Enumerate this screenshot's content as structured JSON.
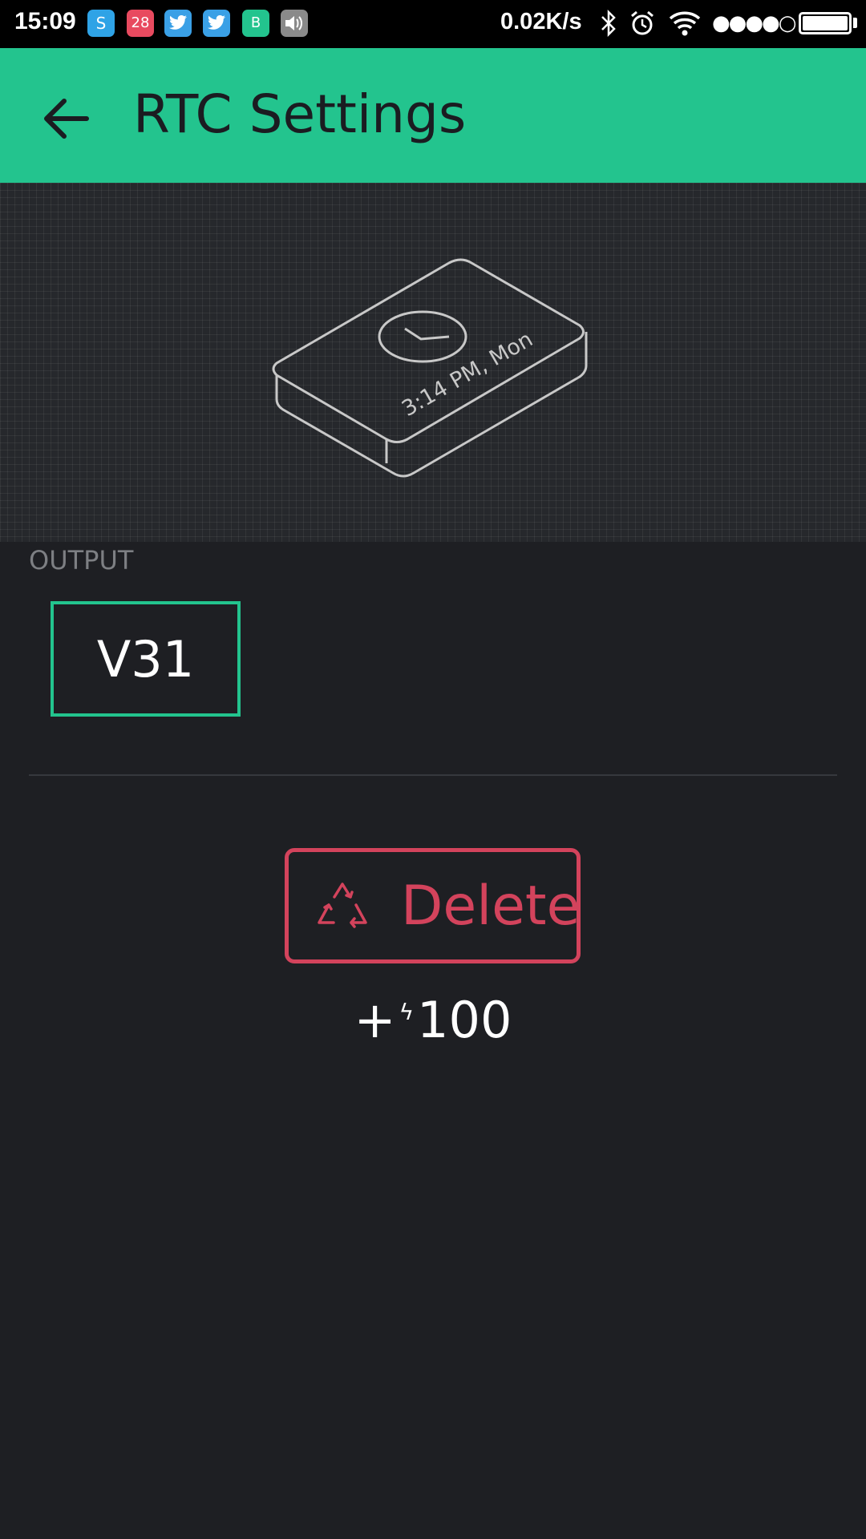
{
  "status_bar": {
    "time": "15:09",
    "notification_icons": [
      {
        "name": "skype-icon",
        "glyph": "S",
        "color": "#2fa3e6"
      },
      {
        "name": "calendar-icon",
        "glyph": "28",
        "color": "#e84a5f"
      },
      {
        "name": "twitter-icon",
        "glyph": "🐦",
        "color": "#3aa0e6"
      },
      {
        "name": "twitter-icon",
        "glyph": "🐦",
        "color": "#3aa0e6"
      },
      {
        "name": "blynk-icon",
        "glyph": "B",
        "color": "#23c48e"
      },
      {
        "name": "volume-icon",
        "glyph": "🔊",
        "color": "#8a8a8a"
      }
    ],
    "net_speed": "0.02K/s",
    "signal": "●●●●○"
  },
  "appbar": {
    "title": "RTC Settings",
    "color": "#23c48e"
  },
  "preview": {
    "device_text": "3:14 PM, Mon"
  },
  "output": {
    "label": "OUTPUT",
    "pin": "V31"
  },
  "delete": {
    "label": "Delete",
    "color": "#d3435c"
  },
  "energy": {
    "prefix": "+",
    "icon": "bolt-icon",
    "value": "100"
  }
}
